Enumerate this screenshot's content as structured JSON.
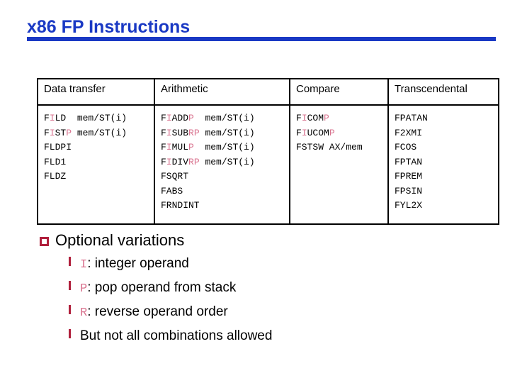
{
  "slide": {
    "title": "x86 FP Instructions",
    "title_color": "#1a39c4",
    "accent_color": "#b01f3c",
    "highlight_color": "#d9738f"
  },
  "table": {
    "headers": [
      "Data transfer",
      "Arithmetic",
      "Compare",
      "Transcendental"
    ],
    "columns": [
      {
        "name": "Data transfer",
        "rows": [
          {
            "parts": [
              {
                "t": "F",
                "hl": false
              },
              {
                "t": "I",
                "hl": true
              },
              {
                "t": "LD  mem/ST(i)",
                "hl": false
              }
            ],
            "plain": "FILD  mem/ST(i)"
          },
          {
            "parts": [
              {
                "t": "F",
                "hl": false
              },
              {
                "t": "I",
                "hl": true
              },
              {
                "t": "ST",
                "hl": false
              },
              {
                "t": "P",
                "hl": true
              },
              {
                "t": " mem/ST(i)",
                "hl": false
              }
            ],
            "plain": "FISTP mem/ST(i)"
          },
          {
            "parts": [
              {
                "t": "FLDPI",
                "hl": false
              }
            ],
            "plain": "FLDPI"
          },
          {
            "parts": [
              {
                "t": "FLD1",
                "hl": false
              }
            ],
            "plain": "FLD1"
          },
          {
            "parts": [
              {
                "t": "FLDZ",
                "hl": false
              }
            ],
            "plain": "FLDZ"
          }
        ]
      },
      {
        "name": "Arithmetic",
        "rows": [
          {
            "parts": [
              {
                "t": "F",
                "hl": false
              },
              {
                "t": "I",
                "hl": true
              },
              {
                "t": "ADD",
                "hl": false
              },
              {
                "t": "P",
                "hl": true
              },
              {
                "t": "  mem/ST(i)",
                "hl": false
              }
            ],
            "plain": "FIADDP  mem/ST(i)"
          },
          {
            "parts": [
              {
                "t": "F",
                "hl": false
              },
              {
                "t": "I",
                "hl": true
              },
              {
                "t": "SUB",
                "hl": false
              },
              {
                "t": "RP",
                "hl": true
              },
              {
                "t": " mem/ST(i)",
                "hl": false
              }
            ],
            "plain": "FISUBRP mem/ST(i)"
          },
          {
            "parts": [
              {
                "t": "F",
                "hl": false
              },
              {
                "t": "I",
                "hl": true
              },
              {
                "t": "MUL",
                "hl": false
              },
              {
                "t": "P",
                "hl": true
              },
              {
                "t": "  mem/ST(i)",
                "hl": false
              }
            ],
            "plain": "FIMULP  mem/ST(i)"
          },
          {
            "parts": [
              {
                "t": "F",
                "hl": false
              },
              {
                "t": "I",
                "hl": true
              },
              {
                "t": "DIV",
                "hl": false
              },
              {
                "t": "RP",
                "hl": true
              },
              {
                "t": " mem/ST(i)",
                "hl": false
              }
            ],
            "plain": "FIDIVRP mem/ST(i)"
          },
          {
            "parts": [
              {
                "t": "FSQRT",
                "hl": false
              }
            ],
            "plain": "FSQRT"
          },
          {
            "parts": [
              {
                "t": "FABS",
                "hl": false
              }
            ],
            "plain": "FABS"
          },
          {
            "parts": [
              {
                "t": "FRNDINT",
                "hl": false
              }
            ],
            "plain": "FRNDINT"
          }
        ]
      },
      {
        "name": "Compare",
        "rows": [
          {
            "parts": [
              {
                "t": "F",
                "hl": false
              },
              {
                "t": "I",
                "hl": true
              },
              {
                "t": "COM",
                "hl": false
              },
              {
                "t": "P",
                "hl": true
              }
            ],
            "plain": "FICOMP"
          },
          {
            "parts": [
              {
                "t": "F",
                "hl": false
              },
              {
                "t": "I",
                "hl": true
              },
              {
                "t": "UCOM",
                "hl": false
              },
              {
                "t": "P",
                "hl": true
              }
            ],
            "plain": "FIUCOMP"
          },
          {
            "parts": [
              {
                "t": "FSTSW AX/mem",
                "hl": false
              }
            ],
            "plain": "FSTSW AX/mem"
          }
        ]
      },
      {
        "name": "Transcendental",
        "rows": [
          {
            "parts": [
              {
                "t": "FPATAN",
                "hl": false
              }
            ],
            "plain": "FPATAN"
          },
          {
            "parts": [
              {
                "t": "F2XMI",
                "hl": false
              }
            ],
            "plain": "F2XMI"
          },
          {
            "parts": [
              {
                "t": "FCOS",
                "hl": false
              }
            ],
            "plain": "FCOS"
          },
          {
            "parts": [
              {
                "t": "FPTAN",
                "hl": false
              }
            ],
            "plain": "FPTAN"
          },
          {
            "parts": [
              {
                "t": "FPREM",
                "hl": false
              }
            ],
            "plain": "FPREM"
          },
          {
            "parts": [
              {
                "t": "FPSIN",
                "hl": false
              }
            ],
            "plain": "FPSIN"
          },
          {
            "parts": [
              {
                "t": "FYL2X",
                "hl": false
              }
            ],
            "plain": "FYL2X"
          }
        ]
      }
    ]
  },
  "bullets": {
    "level1": "Optional variations",
    "sub_items": [
      {
        "code": "I",
        "text": ": integer operand"
      },
      {
        "code": "P",
        "text": ": pop operand from stack"
      },
      {
        "code": "R",
        "text": ": reverse operand order"
      },
      {
        "code": "",
        "text": "But not all combinations allowed"
      }
    ]
  }
}
